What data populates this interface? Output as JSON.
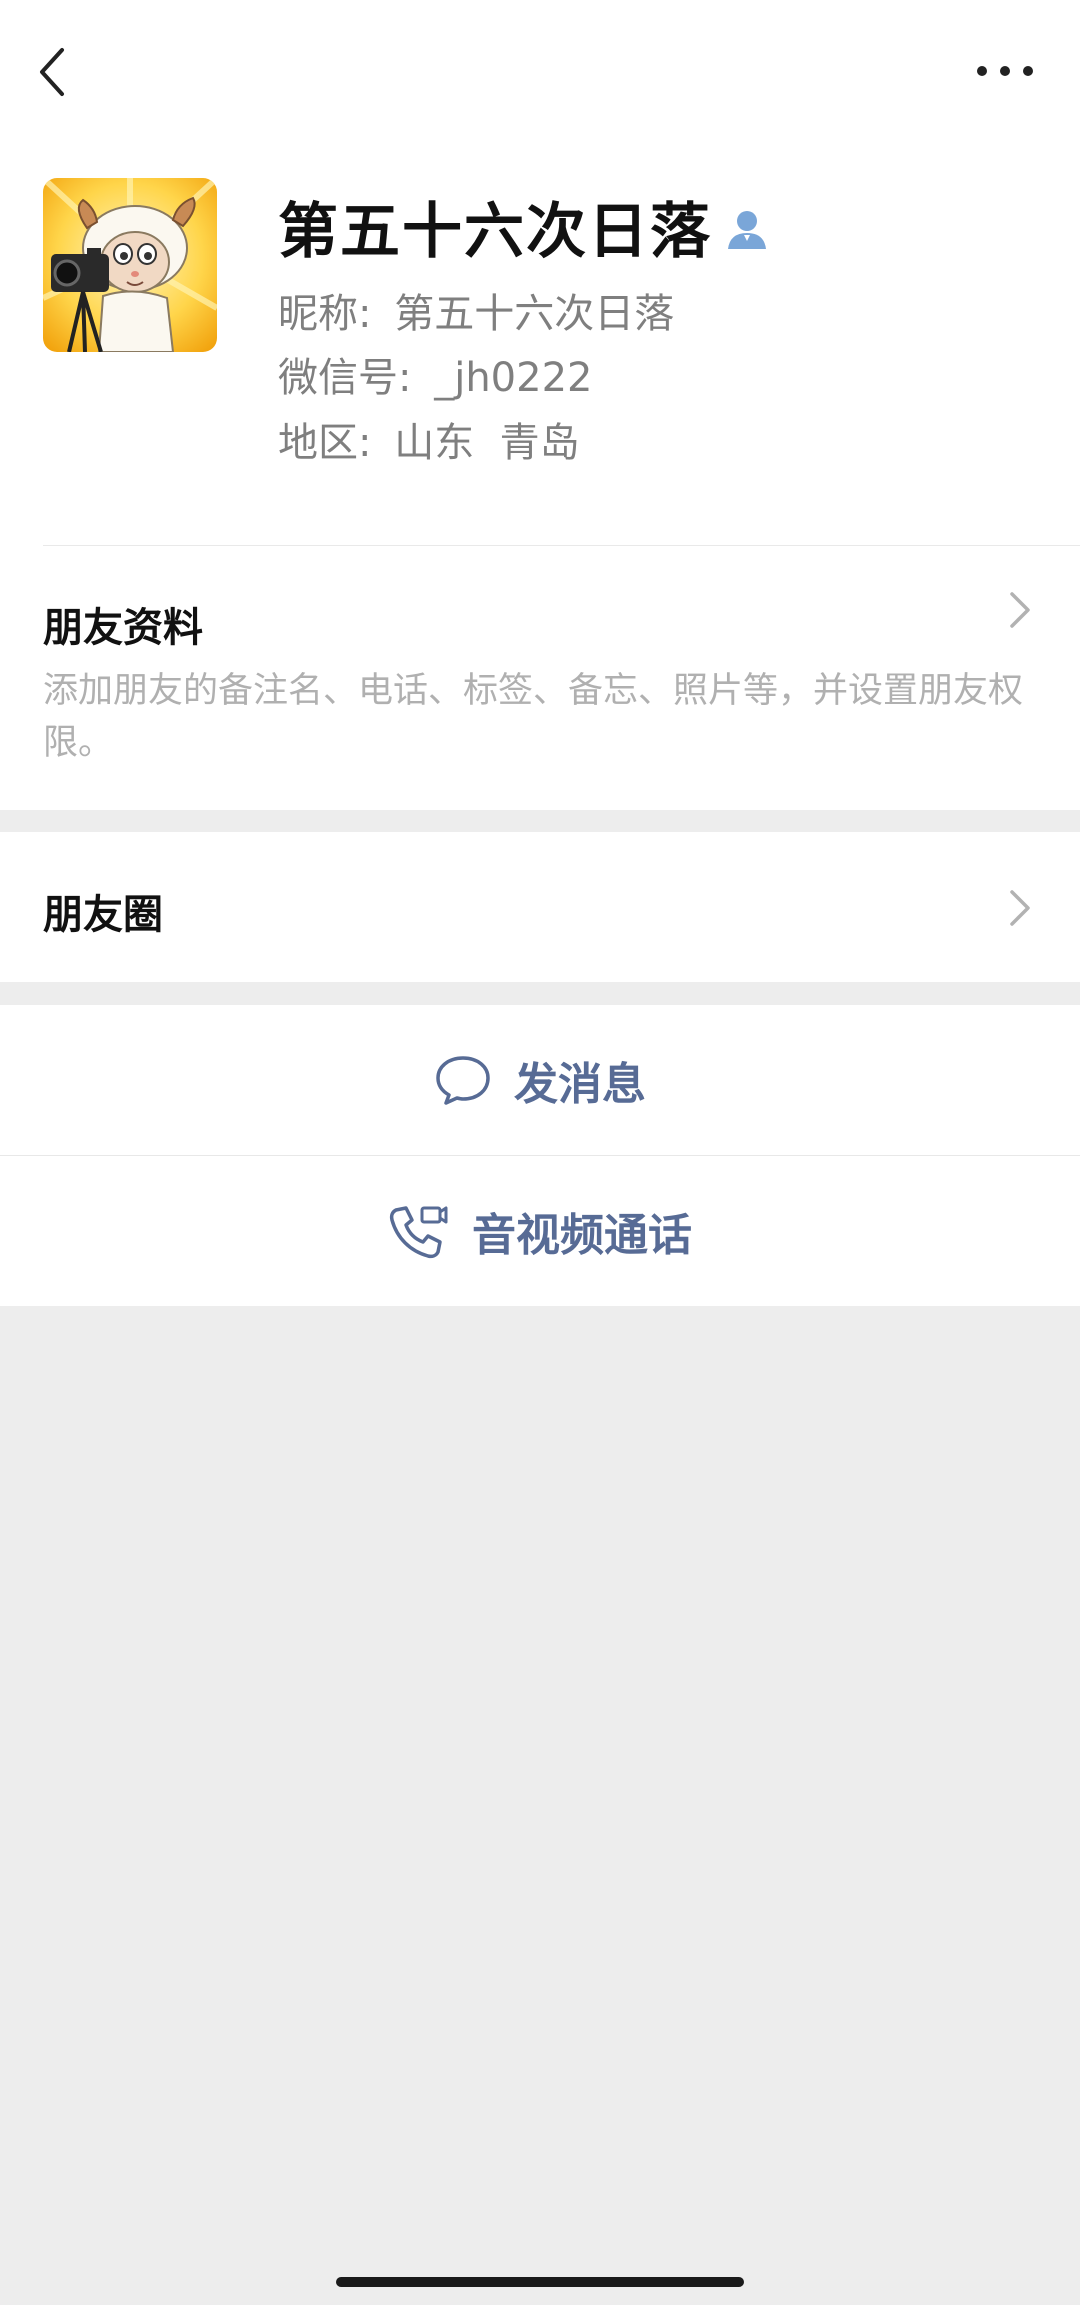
{
  "header": {
    "back_icon": "back-chevron-icon",
    "more_icon": "more-dots-icon"
  },
  "profile": {
    "display_name": "第五十六次日落",
    "nickname_label": "昵称:",
    "nickname": "第五十六次日落",
    "wechat_id_label": "微信号:",
    "wechat_id": "_jh0222",
    "region_label": "地区:",
    "region": "山东  青岛",
    "contact_icon": "contact-person-icon"
  },
  "friend_profile": {
    "title": "朋友资料",
    "description": "添加朋友的备注名、电话、标签、备忘、照片等，并设置朋友权限。"
  },
  "moments": {
    "title": "朋友圈"
  },
  "actions": {
    "message_label": "发消息",
    "call_label": "音视频通话"
  },
  "colors": {
    "accent": "#576b95",
    "background": "#ededed",
    "card": "#ffffff"
  }
}
